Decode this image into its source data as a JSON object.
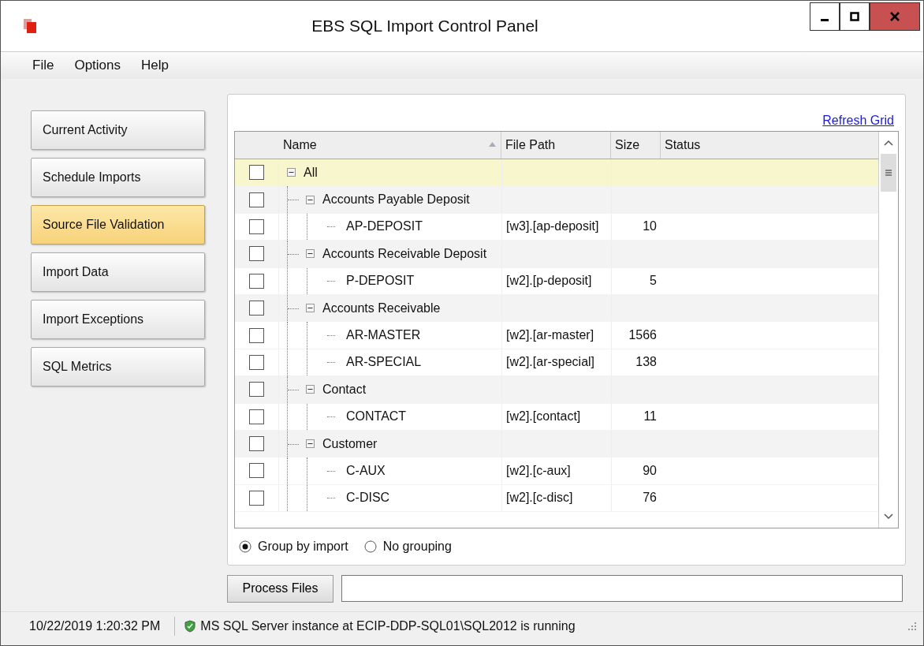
{
  "window": {
    "title": "EBS SQL Import Control Panel"
  },
  "menu": [
    "File",
    "Options",
    "Help"
  ],
  "sidebar": {
    "items": [
      {
        "label": "Current Activity",
        "selected": false
      },
      {
        "label": "Schedule Imports",
        "selected": false
      },
      {
        "label": "Source File Validation",
        "selected": true
      },
      {
        "label": "Import Data",
        "selected": false
      },
      {
        "label": "Import Exceptions",
        "selected": false
      },
      {
        "label": "SQL Metrics",
        "selected": false
      }
    ]
  },
  "refresh_link": "Refresh Grid",
  "grid": {
    "columns": [
      "Name",
      "File Path",
      "Size",
      "Status"
    ],
    "rows": [
      {
        "name": "All",
        "checked": false,
        "selected": true,
        "expanded": true,
        "children": [
          {
            "name": "Accounts Payable Deposit",
            "checked": false,
            "selected": false,
            "expanded": true,
            "children": [
              {
                "name": "AP-DEPOSIT",
                "file_path": "[w3].[ap-deposit]",
                "size": "10",
                "checked": false,
                "selected": false
              }
            ]
          },
          {
            "name": "Accounts Receivable Deposit",
            "checked": false,
            "selected": false,
            "expanded": true,
            "children": [
              {
                "name": "P-DEPOSIT",
                "file_path": "[w2].[p-deposit]",
                "size": "5",
                "checked": false,
                "selected": false
              }
            ]
          },
          {
            "name": "Accounts Receivable",
            "checked": false,
            "selected": false,
            "expanded": true,
            "children": [
              {
                "name": "AR-MASTER",
                "file_path": "[w2].[ar-master]",
                "size": "1566",
                "checked": false,
                "selected": false
              },
              {
                "name": "AR-SPECIAL",
                "file_path": "[w2].[ar-special]",
                "size": "138",
                "checked": false,
                "selected": false
              }
            ]
          },
          {
            "name": "Contact",
            "checked": false,
            "selected": false,
            "expanded": true,
            "children": [
              {
                "name": "CONTACT",
                "file_path": "[w2].[contact]",
                "size": "11",
                "checked": false,
                "selected": false
              }
            ]
          },
          {
            "name": "Customer",
            "checked": false,
            "selected": false,
            "expanded": true,
            "children": [
              {
                "name": "C-AUX",
                "file_path": "[w2].[c-aux]",
                "size": "90",
                "checked": false,
                "selected": false
              },
              {
                "name": "C-DISC",
                "file_path": "[w2].[c-disc]",
                "size": "76",
                "checked": false,
                "selected": false
              }
            ]
          }
        ]
      }
    ]
  },
  "grouping": [
    {
      "label": "Group by import",
      "selected": true
    },
    {
      "label": "No grouping",
      "selected": false
    }
  ],
  "process_button": "Process Files",
  "status_bar": {
    "timestamp": "10/22/2019 1:20:32 PM",
    "message": "MS SQL Server instance at ECIP-DDP-SQL01\\SQL2012 is running"
  }
}
